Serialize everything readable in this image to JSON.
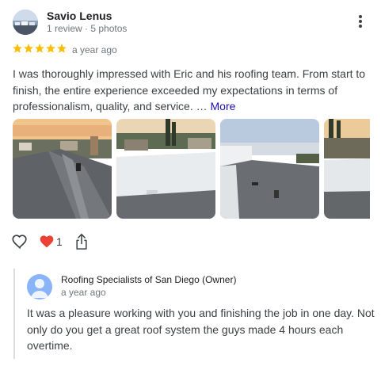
{
  "reviewer": {
    "name": "Savio Lenus",
    "meta": "1 review · 5 photos"
  },
  "review": {
    "rating": 5,
    "date": "a year ago",
    "text": "I was thoroughly impressed with Eric and his roofing team. From start to finish, the entire experience exceeded my expectations in terms of professionalism, quality, and service. …",
    "more_label": "More"
  },
  "photos": [
    {
      "icon": "roof-photo-1"
    },
    {
      "icon": "roof-photo-2"
    },
    {
      "icon": "roof-photo-3"
    },
    {
      "icon": "roof-photo-4"
    }
  ],
  "actions": {
    "like_icon": "heart-outline-icon",
    "reaction_icon": "red-heart-icon",
    "reaction_count": "1",
    "share_icon": "share-icon"
  },
  "owner_response": {
    "name": "Roofing Specialists of San Diego (Owner)",
    "date": "a year ago",
    "text": "It was a pleasure working with you and finishing the job in one day. Not only do you get a great roof system the guys made 4 hours each overtime."
  },
  "colors": {
    "star": "#fbbc04",
    "link": "#1a0dab",
    "heart": "#ea4335",
    "owner_avatar": "#8ab4f8"
  }
}
